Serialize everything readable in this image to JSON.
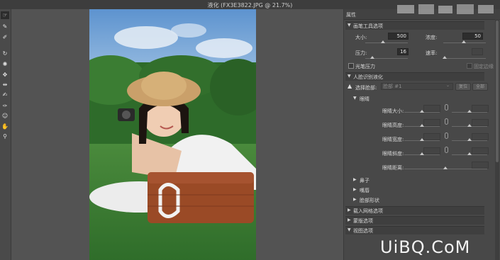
{
  "window": {
    "title": "液化 (FX3E3822.JPG @ 21.7%)"
  },
  "tools": [
    {
      "icon": "forward-warp-icon",
      "glyph": "☞"
    },
    {
      "icon": "reconstruct-icon",
      "glyph": "✎"
    },
    {
      "icon": "smooth-icon",
      "glyph": "✐"
    },
    {
      "icon": "twirl-icon",
      "glyph": "↻"
    },
    {
      "icon": "pucker-icon",
      "glyph": "✺"
    },
    {
      "icon": "bloat-icon",
      "glyph": "✥"
    },
    {
      "icon": "push-left-icon",
      "glyph": "⇹"
    },
    {
      "icon": "freeze-mask-icon",
      "glyph": "✍"
    },
    {
      "icon": "thaw-mask-icon",
      "glyph": "✑"
    },
    {
      "icon": "face-tool-icon",
      "glyph": "☺"
    },
    {
      "icon": "hand-icon",
      "glyph": "✋"
    },
    {
      "icon": "zoom-icon",
      "glyph": "⚲"
    }
  ],
  "panel": {
    "title": "属性",
    "brush_section": "画笔工具选项",
    "size_label": "大小:",
    "size_value": "500",
    "density_label": "浓度:",
    "density_value": "50",
    "pressure_label": "压力:",
    "pressure_value": "16",
    "rate_label": "速率:",
    "rate_value": "",
    "stylus_label": "光笔压力",
    "pin_edges_label": "固定边缘",
    "face_section": "人脸识别液化",
    "select_face_label": "选择脸部:",
    "select_face_value": "脸部 #1",
    "reset_button": "复位",
    "all_button": "全部",
    "eyes_section": "眼睛",
    "eye_params": [
      "眼睛大小:",
      "眼睛高度:",
      "眼睛宽度:",
      "眼睛斜度:",
      "眼睛距离:"
    ],
    "nose_section": "鼻子",
    "mouth_section": "嘴唇",
    "face_shape_section": "脸部形状",
    "load_mesh_section": "载入网格选项",
    "mask_section": "蒙版选项",
    "view_section": "视图选项"
  },
  "watermark": "UiBQ.CoM"
}
